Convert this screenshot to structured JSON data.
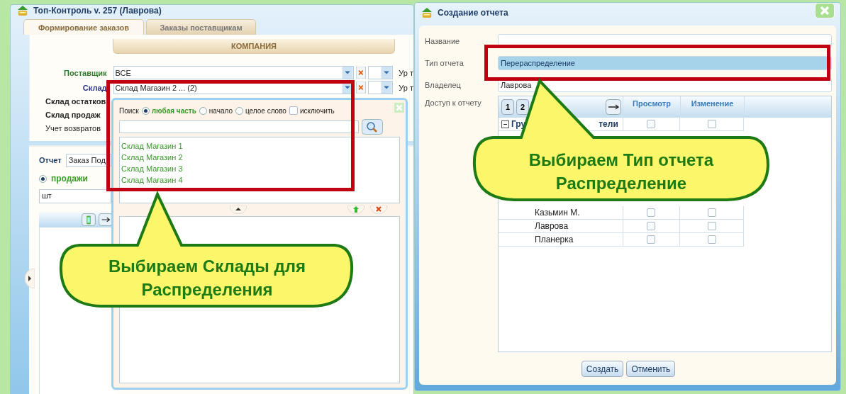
{
  "left_window": {
    "title": "Топ-Контроль v. 257 (Лаврова)",
    "tabs": [
      {
        "label": "Формирование заказов",
        "selected": true
      },
      {
        "label": "Заказы поставщикам",
        "selected": false
      }
    ],
    "section_header": "КОМПАНИЯ",
    "filters": [
      {
        "label": "Поставщик",
        "value": "ВСЕ",
        "side_label": "Ур т"
      },
      {
        "label": "Склад",
        "value": "Склад Магазин 2 ... (2)",
        "side_label": "Ур т"
      }
    ],
    "other_labels": [
      "Склад остатков",
      "Склад продаж",
      "Учет возвратов"
    ],
    "report": {
      "label": "Отчет",
      "value": "Заказ Под"
    },
    "mode_radio": {
      "label": "продажи",
      "selected": true
    },
    "unit_field": {
      "value": "шт"
    }
  },
  "store_popup": {
    "search_label": "Поиск",
    "options": [
      {
        "label": "любая часть",
        "selected": true
      },
      {
        "label": "начало",
        "selected": false
      },
      {
        "label": "целое слово",
        "selected": false
      }
    ],
    "exclude": {
      "label": "исключить",
      "checked": false
    },
    "items": [
      "Склад Магазин 1",
      "Склад Магазин 2",
      "Склад Магазин 3",
      "Склад Магазин 4"
    ]
  },
  "report_dialog": {
    "title": "Создание отчета",
    "fields": [
      {
        "label": "Название",
        "highlighted": false
      },
      {
        "label": "Тип отчета",
        "value": "Перераспределение",
        "highlighted": true
      },
      {
        "label": "Владелец",
        "value": "Лаврова",
        "highlighted": false
      }
    ],
    "access_label": "Доступ к отчету",
    "pages": [
      "1",
      "2"
    ],
    "columns": [
      "Просмотр",
      "Изменение"
    ],
    "group_row": {
      "label_start": "Гру",
      "label_end": "тели",
      "expanded": true,
      "view": false,
      "edit": false
    },
    "rows": [
      {
        "name": "Казьмин М.",
        "view": false,
        "edit": false
      },
      {
        "name": "Лаврова",
        "view": false,
        "edit": false
      },
      {
        "name": "Планерка",
        "view": false,
        "edit": false
      }
    ],
    "buttons": [
      "Создать",
      "Отменить"
    ]
  },
  "callouts": [
    {
      "lines": [
        "Выбираем Склады для",
        "Распределения"
      ]
    },
    {
      "lines": [
        "Выбираем Тип отчета",
        "Распределение"
      ]
    }
  ]
}
